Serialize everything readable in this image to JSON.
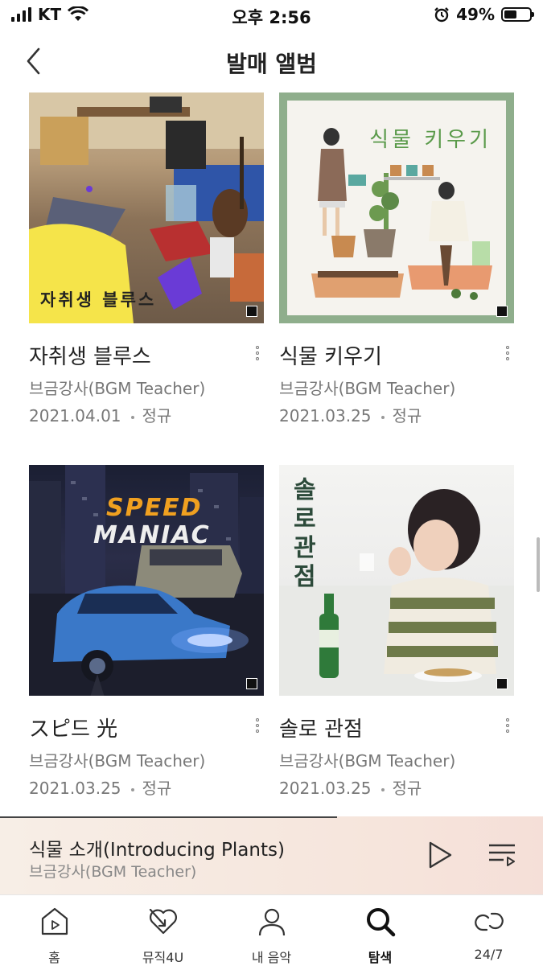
{
  "status_bar": {
    "carrier": "KT",
    "time": "오후 2:56",
    "battery": "49%",
    "battery_level": 0.49
  },
  "header": {
    "title": "발매 앨범",
    "back_icon": "chevron-left-icon"
  },
  "albums": [
    {
      "title": "자취생 블루스",
      "cover_text": "자취생 블루스",
      "artist": "브금강사(BGM Teacher)",
      "date": "2021.04.01",
      "type": "정규"
    },
    {
      "title": "식물 키우기",
      "cover_text": "식물 키우기",
      "artist": "브금강사(BGM Teacher)",
      "date": "2021.03.25",
      "type": "정규"
    },
    {
      "title": "スピ드 光",
      "cover_text_top": "SPEED",
      "cover_text_bottom": "MANIAC",
      "artist": "브금강사(BGM Teacher)",
      "date": "2021.03.25",
      "type": "정규"
    },
    {
      "title": "솔로 관점",
      "cover_text": "솔로 관점",
      "artist": "브금강사(BGM Teacher)",
      "date": "2021.03.25",
      "type": "정규"
    }
  ],
  "player": {
    "title": "식물 소개(Introducing Plants)",
    "artist": "브금강사(BGM Teacher)",
    "progress": 0.62,
    "play_icon": "play-icon",
    "playlist_icon": "playlist-icon"
  },
  "tabs": [
    {
      "label": "홈",
      "icon": "home-play-icon"
    },
    {
      "label": "뮤직4U",
      "icon": "heart-arrow-icon"
    },
    {
      "label": "내 음악",
      "icon": "person-icon"
    },
    {
      "label": "탐색",
      "icon": "search-icon",
      "active": true
    },
    {
      "label": "24/7",
      "icon": "infinity-loop-icon"
    }
  ],
  "colors": {
    "accent_yellow": "#f5e44a",
    "purple": "#6a3bd6",
    "green_frame": "#8fae8c",
    "player_bg": "#f6e5dc"
  }
}
